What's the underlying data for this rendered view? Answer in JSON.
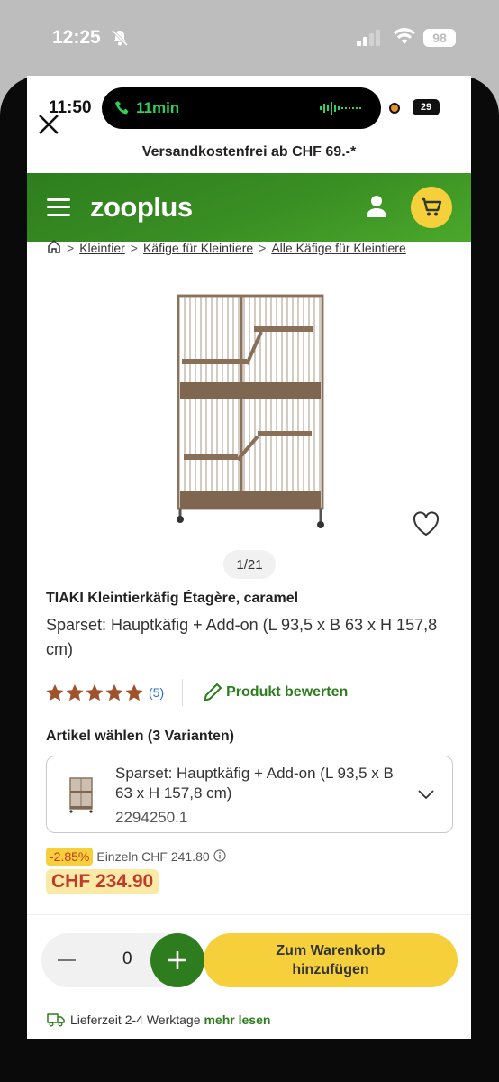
{
  "outer_status": {
    "time": "12:25",
    "battery": "98"
  },
  "inner_status": {
    "time": "11:50",
    "call_duration": "11min",
    "battery": "29"
  },
  "shipping_banner": "Versandkostenfrei ab CHF 69.-*",
  "header": {
    "logo": "zooplus"
  },
  "breadcrumb": [
    "Kleintier",
    "Käfige für Kleintiere",
    "Alle Käfige für Kleintiere"
  ],
  "gallery": {
    "pager": "1/21"
  },
  "product": {
    "title": "TIAKI Kleintierkäfig Étagère, caramel",
    "subtitle": "Sparset: Hauptkäfig + Add-on (L 93,5 x B 63 x H 157,8 cm)",
    "rating_stars": 5,
    "rating_count": "(5)",
    "review_link": "Produkt bewerten"
  },
  "variants": {
    "label": "Artikel wählen (3 Varianten)",
    "selected_name": "Sparset: Hauptkäfig + Add-on (L 93,5 x B 63 x H 157,8 cm)",
    "selected_sku": "2294250.1"
  },
  "pricing": {
    "discount": "-2.85%",
    "single_price": "Einzeln CHF 241.80",
    "price": "CHF 234.90"
  },
  "cart": {
    "quantity": "0",
    "add_label_line1": "Zum Warenkorb",
    "add_label_line2": "hinzufügen"
  },
  "delivery": {
    "text": "Lieferzeit 2-4 Werktage",
    "more": "mehr lesen"
  },
  "colors": {
    "brand_green": "#2d7d1e",
    "accent_yellow": "#f5d03b",
    "price_red": "#c0392b"
  }
}
